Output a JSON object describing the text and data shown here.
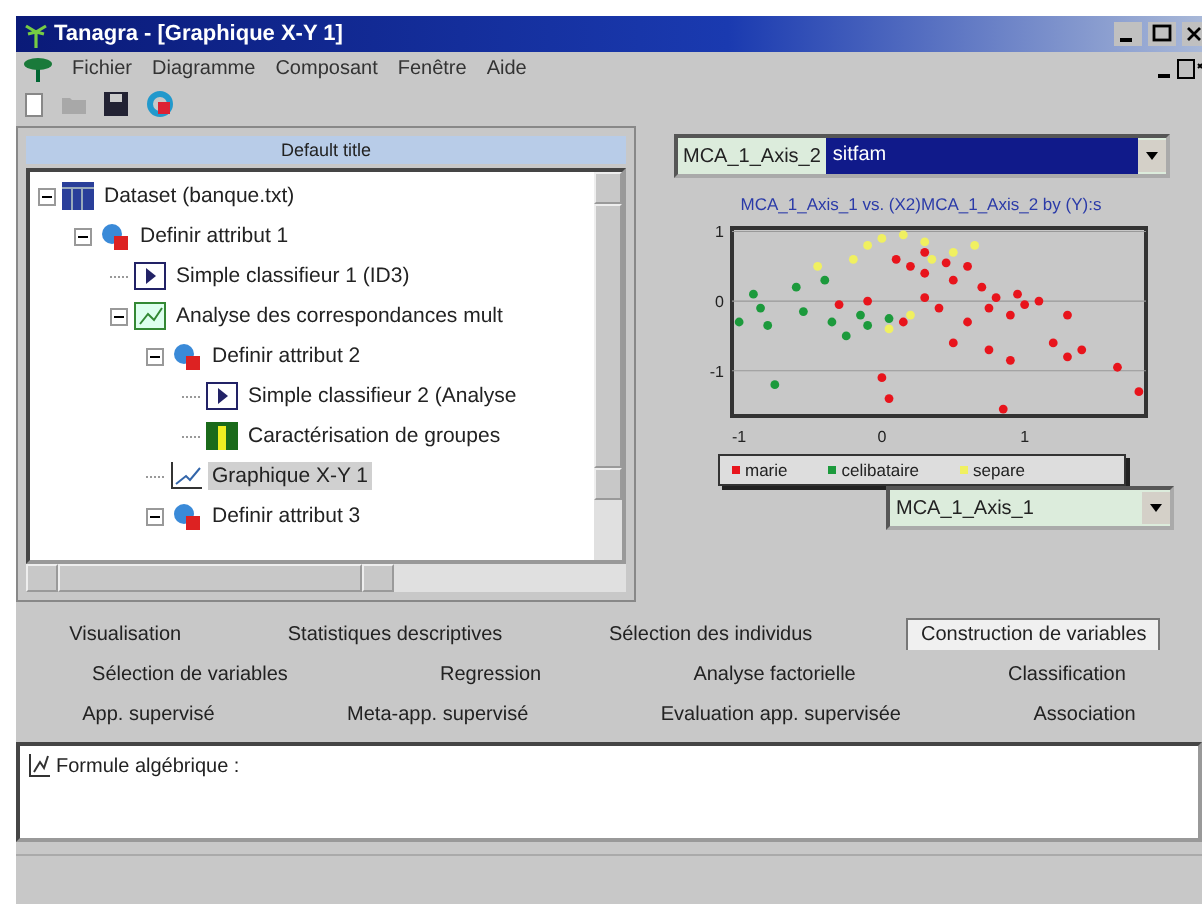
{
  "window": {
    "title": "Tanagra - [Graphique X-Y 1]"
  },
  "menu": [
    "Fichier",
    "Diagramme",
    "Composant",
    "Fenêtre",
    "Aide"
  ],
  "diagram": {
    "title": "Default title",
    "tree": [
      {
        "label": "Dataset (banque.txt)",
        "kind": "dataset",
        "expanded": true,
        "selected": false,
        "children": [
          {
            "label": "Definir attribut 1",
            "kind": "define",
            "expanded": true,
            "selected": false,
            "children": [
              {
                "label": "Simple classifieur 1 (ID3)",
                "kind": "classifier",
                "selected": false
              },
              {
                "label": "Analyse des correspondances mult",
                "kind": "mca",
                "expanded": true,
                "selected": false,
                "children": [
                  {
                    "label": "Definir attribut 2",
                    "kind": "define",
                    "expanded": true,
                    "selected": false,
                    "children": [
                      {
                        "label": "Simple classifieur 2 (Analyse",
                        "kind": "classifier",
                        "selected": false
                      },
                      {
                        "label": "Caractérisation de groupes",
                        "kind": "characterization",
                        "selected": false
                      }
                    ]
                  },
                  {
                    "label": "Graphique X-Y 1",
                    "kind": "chart",
                    "selected": true
                  },
                  {
                    "label": "Definir attribut 3",
                    "kind": "define",
                    "expanded": true,
                    "selected": false
                  }
                ]
              }
            ]
          }
        ]
      }
    ]
  },
  "chart_view": {
    "y_select": {
      "value": "MCA_1_Axis_2",
      "highlighted": "sitfam"
    },
    "x_select": {
      "value": "MCA_1_Axis_1"
    },
    "chart_data": {
      "type": "scatter",
      "title": "MCA_1_Axis_1 vs. (X2)MCA_1_Axis_2 by (Y):s",
      "xlim": [
        -1.05,
        1.85
      ],
      "ylim": [
        -1.65,
        1.05
      ],
      "xticks": [
        -1,
        0,
        1
      ],
      "yticks": [
        -1,
        0,
        1
      ],
      "series": [
        {
          "name": "marie",
          "color": "#e8141c",
          "x": [
            0.1,
            0.2,
            0.3,
            0.3,
            0.45,
            0.5,
            0.6,
            0.7,
            0.75,
            0.8,
            0.9,
            0.95,
            1.0,
            1.1,
            0.4,
            0.5,
            0.6,
            0.75,
            0.9,
            1.2,
            1.3,
            1.4,
            1.3,
            1.65,
            1.8,
            0.0,
            0.05,
            0.85,
            0.3,
            0.15,
            -0.3,
            -0.1
          ],
          "values": [
            0.6,
            0.5,
            0.7,
            0.4,
            0.55,
            0.3,
            0.5,
            0.2,
            -0.1,
            0.05,
            -0.2,
            0.1,
            -0.05,
            0.0,
            -0.1,
            -0.6,
            -0.3,
            -0.7,
            -0.85,
            -0.6,
            -0.8,
            -0.7,
            -0.2,
            -0.95,
            -1.3,
            -1.1,
            -1.4,
            -1.55,
            0.05,
            -0.3,
            -0.05,
            0.0
          ]
        },
        {
          "name": "celibataire",
          "color": "#1c9a3c",
          "x": [
            -0.9,
            -0.85,
            -1.0,
            -0.8,
            -0.6,
            -0.55,
            -0.4,
            -0.35,
            -0.25,
            -0.15,
            -0.1,
            0.05,
            -0.75
          ],
          "values": [
            0.1,
            -0.1,
            -0.3,
            -0.35,
            0.2,
            -0.15,
            0.3,
            -0.3,
            -0.5,
            -0.2,
            -0.35,
            -0.25,
            -1.2
          ]
        },
        {
          "name": "separe",
          "color": "#f0f060",
          "x": [
            -0.45,
            -0.2,
            -0.1,
            0.0,
            0.15,
            0.3,
            0.5,
            0.65,
            0.05,
            0.2,
            0.35
          ],
          "values": [
            0.5,
            0.6,
            0.8,
            0.9,
            0.95,
            0.85,
            0.7,
            0.8,
            -0.4,
            -0.2,
            0.6
          ]
        }
      ]
    }
  },
  "component_tabs": [
    [
      {
        "label": "Visualisation",
        "selected": false
      },
      {
        "label": "Statistiques descriptives",
        "selected": false
      },
      {
        "label": "Sélection des individus",
        "selected": false
      },
      {
        "label": "Construction de variables",
        "selected": true
      }
    ],
    [
      {
        "label": "Sélection de variables",
        "selected": false
      },
      {
        "label": "Regression",
        "selected": false
      },
      {
        "label": "Analyse factorielle",
        "selected": false
      },
      {
        "label": "Classification",
        "selected": false
      }
    ],
    [
      {
        "label": "App. supervisé",
        "selected": false
      },
      {
        "label": "Meta-app. supervisé",
        "selected": false
      },
      {
        "label": "Evaluation app. supervisée",
        "selected": false
      },
      {
        "label": "Association",
        "selected": false
      }
    ]
  ],
  "components": [
    {
      "label": "Formule algébrique :"
    }
  ]
}
